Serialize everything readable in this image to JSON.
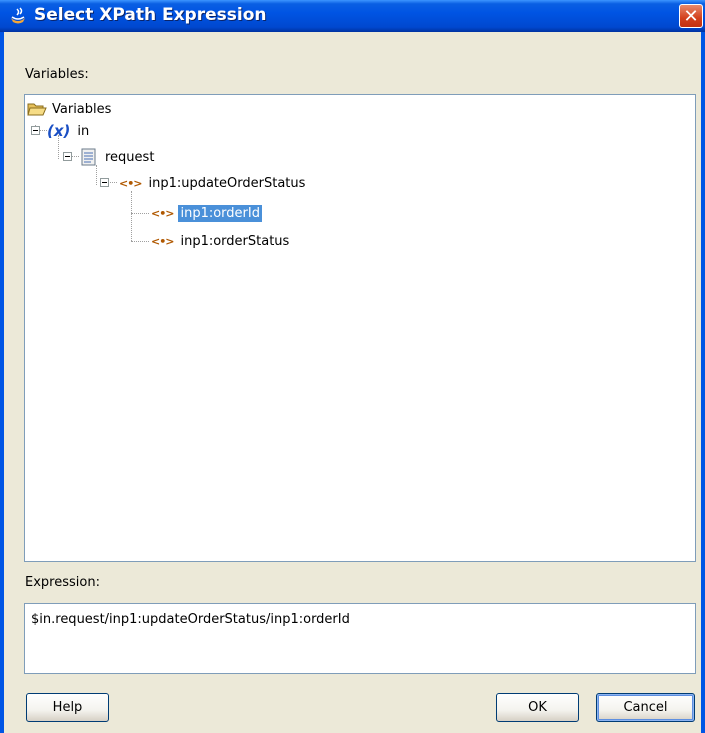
{
  "window": {
    "title": "Select XPath Expression",
    "close_glyph": "✕"
  },
  "variables_label": "Variables:",
  "tree": {
    "root": "Variables",
    "var_in": "in",
    "request": "request",
    "update": "inp1:updateOrderStatus",
    "order_id": "inp1:orderId",
    "order_status": "inp1:orderStatus",
    "var_icon": "(x)",
    "elem_icon": "<•>",
    "selected": "inp1:orderId"
  },
  "expression_label": "Expression:",
  "expression_value": "$in.request/inp1:updateOrderStatus/inp1:orderId",
  "buttons": {
    "help": "Help",
    "ok": "OK",
    "cancel": "Cancel"
  },
  "icons": [
    "app-cup-icon",
    "close-icon",
    "folder-open-icon",
    "variable-icon",
    "document-icon",
    "element-icon"
  ],
  "colors": {
    "titlebar": "#0054e3",
    "selection": "#4a90d9",
    "dialog_bg": "#ece9d8"
  }
}
